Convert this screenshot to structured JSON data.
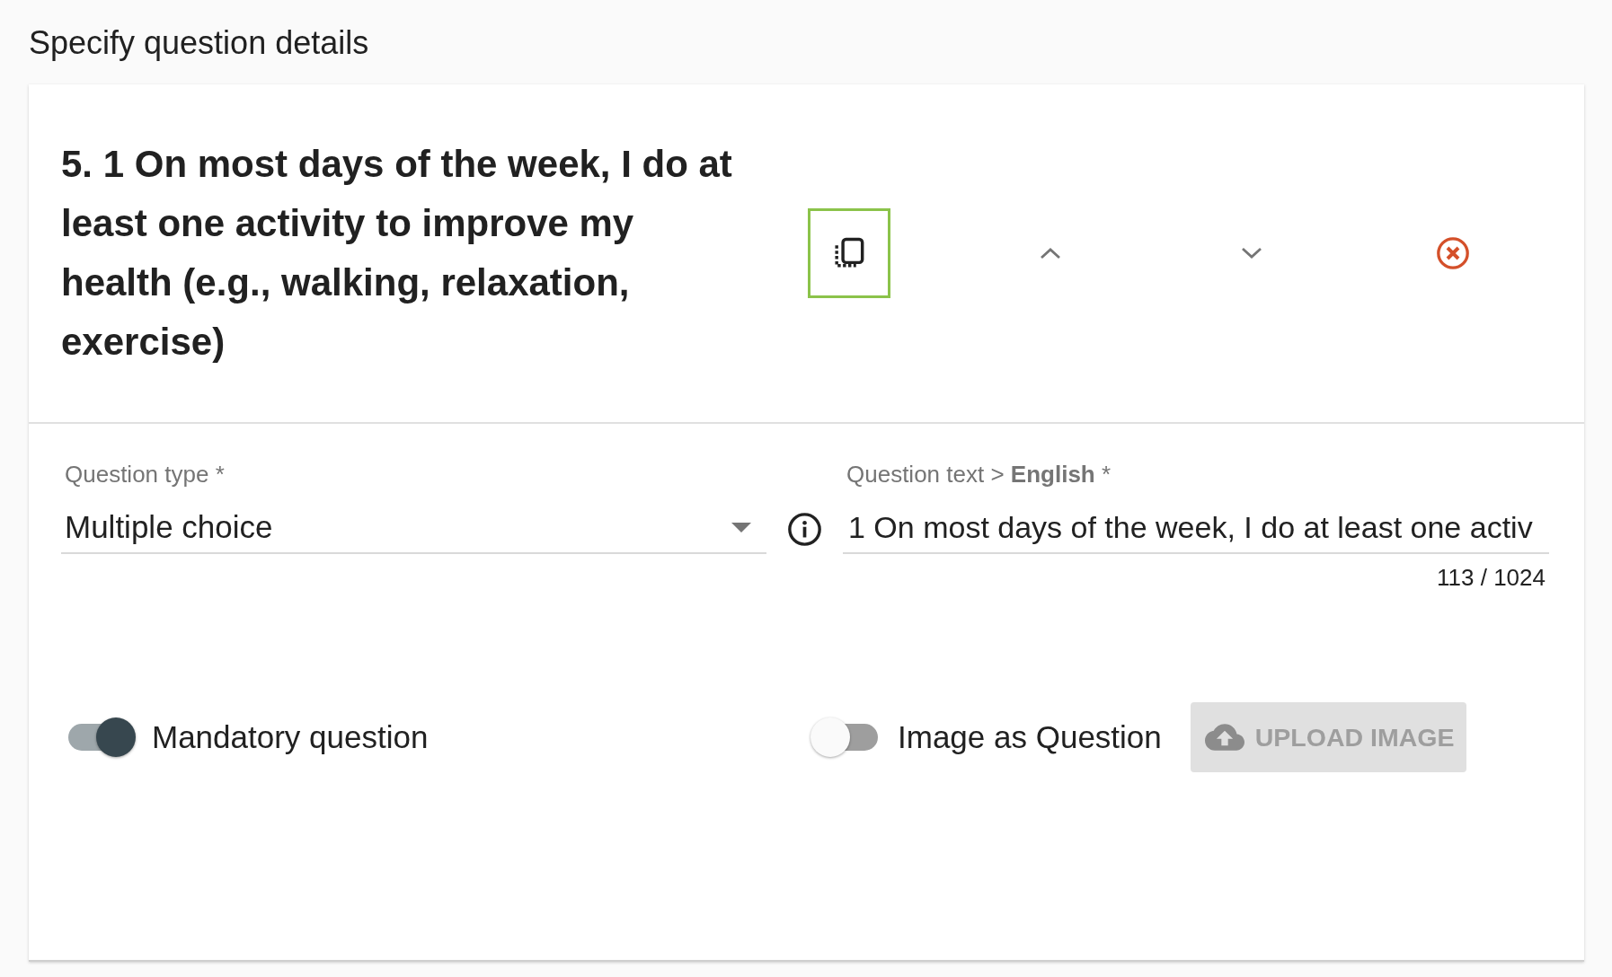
{
  "page_title": "Specify question details",
  "question": {
    "title": "5. 1 On most days of the week, I do at least one activity to improve my health (e.g., walking, relaxation, exercise)",
    "actions": [
      {
        "kind": "duplicate",
        "highlighted": true
      },
      {
        "kind": "move_up",
        "highlighted": false
      },
      {
        "kind": "move_down",
        "highlighted": false
      },
      {
        "kind": "delete",
        "highlighted": false
      }
    ],
    "question_type": {
      "label": "Question type *",
      "value": "Multiple choice"
    },
    "question_text": {
      "label": "Question text > **English** *",
      "value": "1 On most days of the week, I do at least one activ",
      "counter": "113 / 1024"
    },
    "toggles": [
      {
        "label": "Mandatory question",
        "on": true
      },
      {
        "label": "Image as Question",
        "on": false
      }
    ],
    "upload_button": {
      "label": "UPLOAD IMAGE",
      "disabled": true
    }
  }
}
